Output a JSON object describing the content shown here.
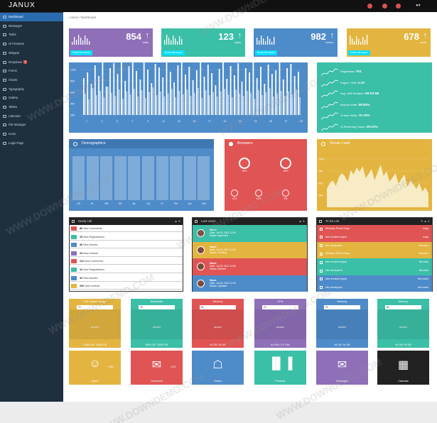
{
  "app": {
    "brand": "JANUX",
    "breadcrumb_home": "Home",
    "breadcrumb_sep": "/",
    "breadcrumb_current": "Dashboard",
    "user_caret": "▾"
  },
  "colors": {
    "purple": "#8e6fb8",
    "teal": "#3bbfa7",
    "blue": "#4e8bc9",
    "yellow": "#e3b540",
    "red": "#e05454",
    "dark": "#1e2f3e",
    "accent": "#2b6cb0"
  },
  "sidebar": {
    "items": [
      {
        "label": "Dashboard",
        "icon": "dashboard-icon",
        "active": true
      },
      {
        "label": "Messages",
        "icon": "envelope-icon"
      },
      {
        "label": "Tasks",
        "icon": "tasks-icon"
      },
      {
        "label": "UI Features",
        "icon": "eye-icon"
      },
      {
        "label": "Widgets",
        "icon": "dashboard-icon"
      },
      {
        "label": "Dropdown",
        "icon": "folder-icon",
        "badge": "3"
      },
      {
        "label": "Forms",
        "icon": "edit-icon"
      },
      {
        "label": "Charts",
        "icon": "list-icon"
      },
      {
        "label": "Typography",
        "icon": "font-icon"
      },
      {
        "label": "Gallery",
        "icon": "picture-icon"
      },
      {
        "label": "Tables",
        "icon": "align-justify-icon"
      },
      {
        "label": "Calendar",
        "icon": "calendar-icon"
      },
      {
        "label": "File Manager",
        "icon": "folder-open-icon"
      },
      {
        "label": "Icons",
        "icon": "star-icon"
      },
      {
        "label": "Login Page",
        "icon": "lock-icon"
      }
    ]
  },
  "stats": [
    {
      "value": "854",
      "label": "visits",
      "footer": "Read full report"
    },
    {
      "value": "123",
      "label": "sales",
      "footer": "Read full report"
    },
    {
      "value": "982",
      "label": "orders",
      "footer": "Read full report"
    },
    {
      "value": "678",
      "label": "users",
      "footer": "Read full report"
    }
  ],
  "main_chart": {
    "y_ticks": [
      "1000",
      "800",
      "600",
      "400",
      "200"
    ],
    "x_ticks": [
      "1",
      "3",
      "5",
      "7",
      "9",
      "11",
      "13",
      "15",
      "17",
      "19",
      "21",
      "23",
      "25",
      "27",
      "29"
    ]
  },
  "side_stats": [
    {
      "label": "Pageviews:",
      "value": "761"
    },
    {
      "label": "Pages / Visit:",
      "value": "2.19"
    },
    {
      "label": "Avg. Visit Duration:",
      "value": "00:02:58"
    },
    {
      "label": "Bounce Rate:",
      "value": "59.83%"
    },
    {
      "label": "% New Visits:",
      "value": "70.79%"
    },
    {
      "label": "% Returning Visitor:",
      "value": "29.21%"
    }
  ],
  "demographics": {
    "title": "Demographics",
    "labels": [
      "US",
      "PL",
      "GB",
      "DE",
      "NL",
      "CA",
      "FI",
      "RU",
      "AU",
      "N/A"
    ]
  },
  "browsers": {
    "title": "Browsers",
    "items": [
      {
        "name": "chrome",
        "pct": "34%"
      },
      {
        "name": "firefox",
        "pct": "28%"
      },
      {
        "name": "ie",
        "pct": "22%"
      },
      {
        "name": "safari",
        "pct": "16%"
      },
      {
        "name": "opera",
        "pct": "8%"
      }
    ]
  },
  "server_load": {
    "title": "Server Load",
    "y_ticks": [
      "100%",
      "75%",
      "50%",
      "25%"
    ]
  },
  "newly": {
    "title": "Newly Util",
    "rows": [
      {
        "count": "80",
        "text": "New Comments"
      },
      {
        "count": "15",
        "text": "New Registrations"
      },
      {
        "count": "36",
        "text": "New Articles"
      },
      {
        "count": "23",
        "text": "New reviews"
      },
      {
        "count": "112",
        "text": "New Comments"
      },
      {
        "count": "10",
        "text": "New Registrations"
      },
      {
        "count": "32",
        "text": "New Articles"
      },
      {
        "count": "200",
        "text": "New reviews"
      }
    ]
  },
  "users": {
    "title": "Last Users",
    "rows": [
      {
        "name": "Name:",
        "date": "Date: Jul 25, 2012 11:09",
        "status": "Status: Approved"
      },
      {
        "name": "Name:",
        "date": "Date: Jul 25, 2012 11:09",
        "status": "Status: Pending"
      },
      {
        "name": "Name:",
        "date": "Date: Jul 25, 2012 11:09",
        "status": "Status: Banned"
      },
      {
        "name": "Name:",
        "date": "Date: Jul 25, 2012 11:09",
        "status": "Status: Updated"
      }
    ]
  },
  "todo": {
    "title": "To Do List",
    "rows": [
      {
        "text": "Windows Phone 8 App",
        "tag": "today"
      },
      {
        "text": "New frontend layout",
        "tag": "today"
      },
      {
        "text": "Hire developers",
        "tag": "tomorrow"
      },
      {
        "text": "Windows Phone 8 App",
        "tag": "tomorrow"
      },
      {
        "text": "New frontend layout",
        "tag": "this week"
      },
      {
        "text": "Hire developers",
        "tag": "this week"
      },
      {
        "text": "New frontend layout",
        "tag": "this month"
      },
      {
        "text": "Hire developers",
        "tag": "this month"
      }
    ]
  },
  "gauges": [
    {
      "title": "Disk Space Usage",
      "input": "70",
      "percent": "percent",
      "footer": "13046 GB / 20000 GB"
    },
    {
      "title": "Bandwidth",
      "input": "75",
      "percent": "percent",
      "footer": "5000 GB / 10000 GB"
    },
    {
      "title": "Memory",
      "input": "60",
      "percent": "percent",
      "footer": "64 GB / 64 GB"
    },
    {
      "title": "CPU",
      "input": "20",
      "percent": "percent",
      "footer": "64 GHz / 3.2 GHz"
    },
    {
      "title": "Memory",
      "input": "30",
      "percent": "percent",
      "footer": "64 GB / 64 GB"
    },
    {
      "title": "Memory",
      "input": "80",
      "percent": "percent",
      "footer": "64 GB / 64 GB"
    }
  ],
  "tiles": [
    {
      "label": "Users",
      "icon": "users-icon",
      "num": "854"
    },
    {
      "label": "Comments",
      "icon": "comments-icon",
      "num": "123"
    },
    {
      "label": "Orders",
      "icon": "cart-icon",
      "num": ""
    },
    {
      "label": "Products",
      "icon": "barcode-icon",
      "num": ""
    },
    {
      "label": "Messages",
      "icon": "envelope-icon",
      "num": ""
    },
    {
      "label": "Calendar",
      "icon": "calendar-icon",
      "num": ""
    }
  ],
  "watermark": "WWW.DOWNDEMO.COM"
}
